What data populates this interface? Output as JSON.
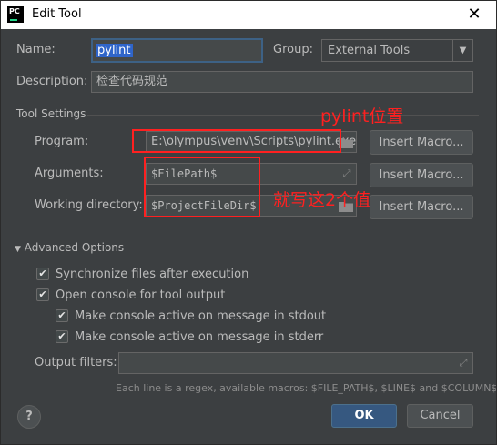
{
  "window": {
    "title": "Edit Tool",
    "app_icon_text": "PC"
  },
  "name": {
    "label": "Name:",
    "value": "pylint"
  },
  "group": {
    "label": "Group:",
    "value": "External Tools"
  },
  "description": {
    "label": "Description:",
    "value": "检查代码规范"
  },
  "tool_settings": {
    "heading": "Tool Settings",
    "program": {
      "label": "Program:",
      "value": "E:\\olympus\\venv\\Scripts\\pylint.exe"
    },
    "arguments": {
      "label": "Arguments:",
      "value": "$FilePath$"
    },
    "working_directory": {
      "label": "Working directory:",
      "value": "$ProjectFileDir$"
    },
    "insert_macro_label": "Insert Macro..."
  },
  "advanced": {
    "heading": "Advanced Options",
    "options": [
      {
        "label": "Synchronize files after execution",
        "checked": true
      },
      {
        "label": "Open console for tool output",
        "checked": true
      },
      {
        "label": "Make console active on message in stdout",
        "checked": true
      },
      {
        "label": "Make console active on message in stderr",
        "checked": true
      }
    ],
    "output_filters_label": "Output filters:",
    "output_filters_value": "",
    "hint": "Each line is a regex, available macros: $FILE_PATH$, $LINE$ and $COLUMN$"
  },
  "annotations": {
    "program": "pylint位置",
    "args": "就写这2个值"
  },
  "footer": {
    "help": "?",
    "ok": "OK",
    "cancel": "Cancel"
  },
  "colors": {
    "annotation": "#ff2020",
    "accent": "#365880",
    "selection": "#2f65ca"
  }
}
